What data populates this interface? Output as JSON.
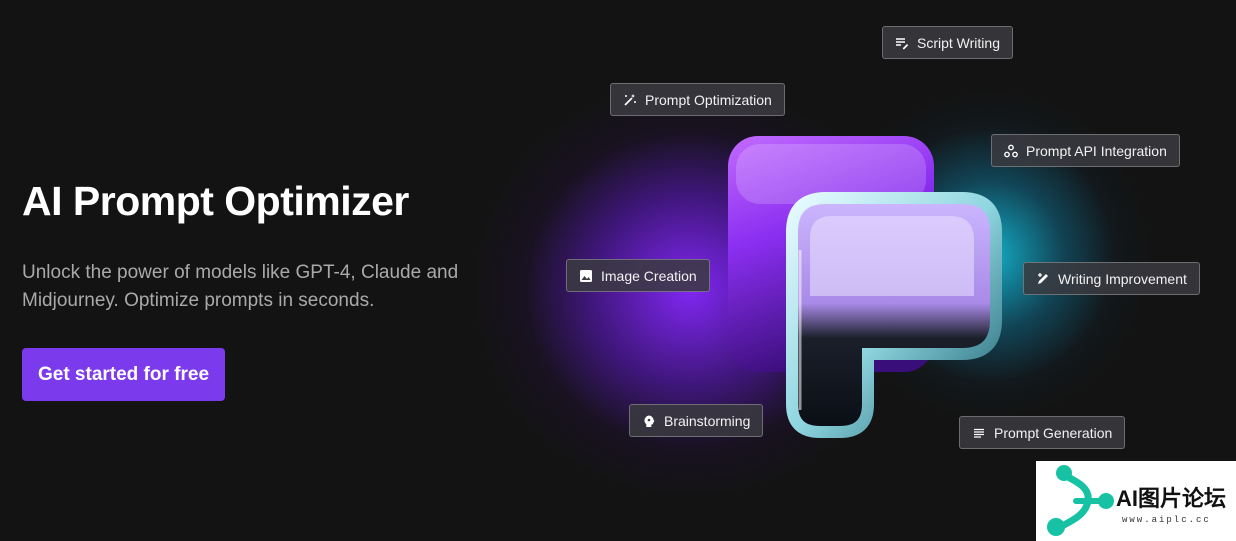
{
  "hero": {
    "title": "AI Prompt Optimizer",
    "subtitle": "Unlock the power of models like GPT-4, Claude and Midjourney. Optimize prompts in seconds.",
    "cta_label": "Get started for free"
  },
  "features": [
    {
      "label": "Script Writing",
      "icon": "script-icon"
    },
    {
      "label": "Prompt Optimization",
      "icon": "magic-wand-icon"
    },
    {
      "label": "Prompt API Integration",
      "icon": "webhook-icon"
    },
    {
      "label": "Image Creation",
      "icon": "image-icon"
    },
    {
      "label": "Writing Improvement",
      "icon": "edit-icon"
    },
    {
      "label": "Brainstorming",
      "icon": "brain-icon"
    },
    {
      "label": "Prompt Generation",
      "icon": "lines-icon"
    }
  ],
  "watermark": {
    "text": "AI图片论坛",
    "url": "www.aiplc.cc"
  },
  "colors": {
    "background": "#131313",
    "cta": "#7c3aed",
    "glow_purple": "#8728ff",
    "glow_cyan": "#14c8e6"
  }
}
